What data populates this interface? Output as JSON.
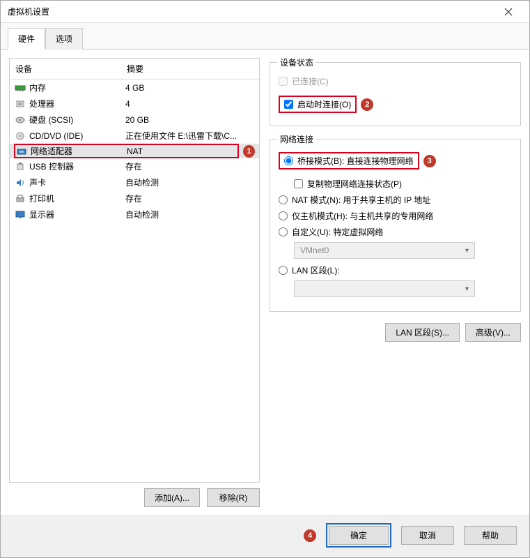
{
  "window": {
    "title": "虚拟机设置"
  },
  "tabs": {
    "hardware": "硬件",
    "options": "选项"
  },
  "device_headers": {
    "device": "设备",
    "summary": "摘要"
  },
  "devices": [
    {
      "icon": "memory-icon",
      "name": "内存",
      "summary": "4 GB"
    },
    {
      "icon": "cpu-icon",
      "name": "处理器",
      "summary": "4"
    },
    {
      "icon": "disk-icon",
      "name": "硬盘 (SCSI)",
      "summary": "20 GB"
    },
    {
      "icon": "cd-icon",
      "name": "CD/DVD (IDE)",
      "summary": "正在使用文件 E:\\迅雷下载\\C..."
    },
    {
      "icon": "net-icon",
      "name": "网络适配器",
      "summary": "NAT",
      "selected": true
    },
    {
      "icon": "usb-icon",
      "name": "USB 控制器",
      "summary": "存在"
    },
    {
      "icon": "sound-icon",
      "name": "声卡",
      "summary": "自动检测"
    },
    {
      "icon": "printer-icon",
      "name": "打印机",
      "summary": "存在"
    },
    {
      "icon": "display-icon",
      "name": "显示器",
      "summary": "自动检测"
    }
  ],
  "left_buttons": {
    "add": "添加(A)...",
    "remove": "移除(R)"
  },
  "device_state": {
    "legend": "设备状态",
    "connected": "已连接(C)",
    "connect_on_power": "启动时连接(O)"
  },
  "network": {
    "legend": "网络连接",
    "bridged": "桥接模式(B): 直接连接物理网络",
    "replicate": "复制物理网络连接状态(P)",
    "nat": "NAT 模式(N): 用于共享主机的 IP 地址",
    "hostonly": "仅主机模式(H): 与主机共享的专用网络",
    "custom": "自定义(U): 特定虚拟网络",
    "custom_value": "VMnet0",
    "lan_segment": "LAN 区段(L):",
    "lan_segment_value": "",
    "btn_lan": "LAN 区段(S)...",
    "btn_advanced": "高级(V)..."
  },
  "footer": {
    "ok": "确定",
    "cancel": "取消",
    "help": "帮助"
  },
  "badges": {
    "b1": "1",
    "b2": "2",
    "b3": "3",
    "b4": "4"
  }
}
